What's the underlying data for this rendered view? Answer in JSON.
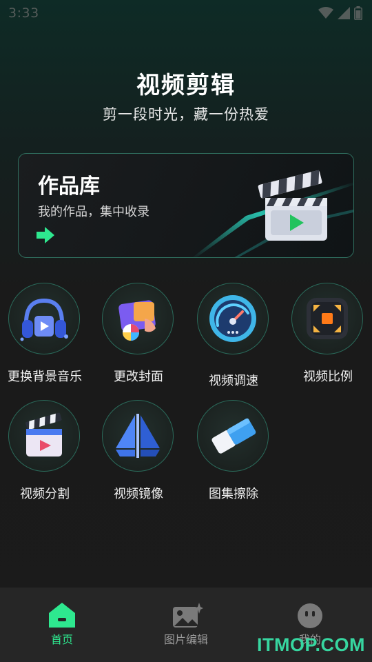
{
  "status_bar": {
    "time": "3:33"
  },
  "header": {
    "title": "视频剪辑",
    "subtitle": "剪一段时光，藏一份热爱"
  },
  "works_card": {
    "title": "作品库",
    "subtitle": "我的作品，集中收录",
    "arrow_icon": "arrow-right-icon",
    "illustration": "clapperboard-icon"
  },
  "tools": [
    {
      "label": "更换背景音乐",
      "icon": "headphones-icon"
    },
    {
      "label": "更改封面",
      "icon": "cover-edit-icon"
    },
    {
      "label": "视频调速",
      "icon": "speedometer-icon"
    },
    {
      "label": "视频比例",
      "icon": "aspect-ratio-icon"
    },
    {
      "label": "视频分割",
      "icon": "clapper-split-icon"
    },
    {
      "label": "视频镜像",
      "icon": "mirror-icon"
    },
    {
      "label": "图集擦除",
      "icon": "eraser-icon"
    }
  ],
  "bottom_nav": [
    {
      "label": "首页",
      "icon": "home-icon",
      "active": true
    },
    {
      "label": "图片编辑",
      "icon": "image-edit-icon",
      "active": false
    },
    {
      "label": "我的",
      "icon": "profile-icon",
      "active": false
    }
  ],
  "watermark": "ITMOP.COM",
  "colors": {
    "accent": "#2ee88f",
    "card_border": "#2f6e5e",
    "nav_bg": "#262626"
  }
}
